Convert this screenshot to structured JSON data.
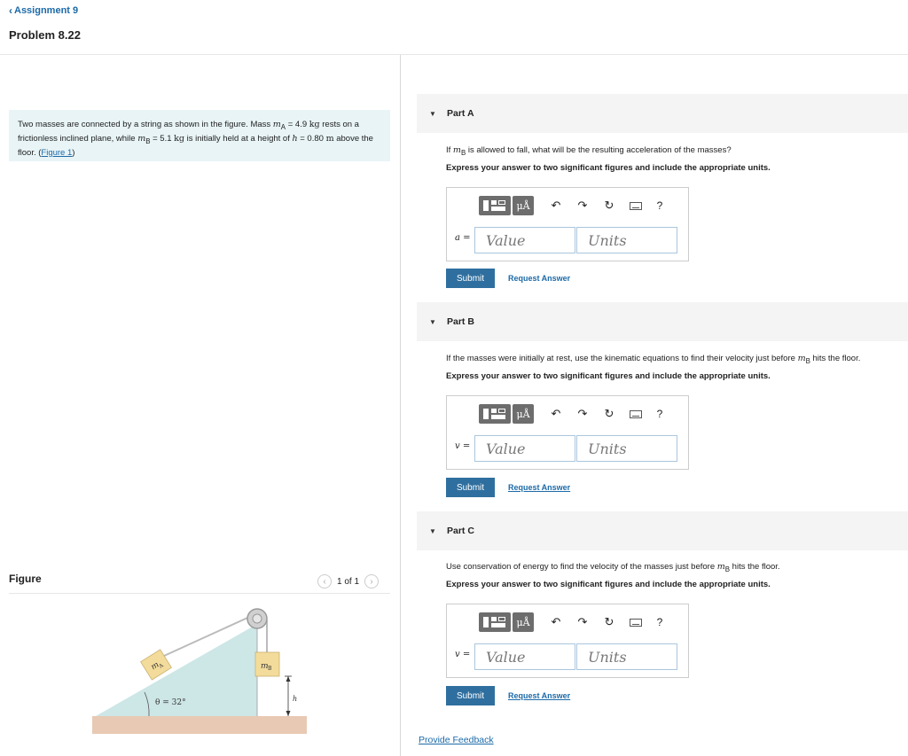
{
  "nav": {
    "back_label": "Assignment 9"
  },
  "problem": {
    "title": "Problem 8.22"
  },
  "statement": {
    "t1": "Two masses are connected by a string as shown in the figure. Mass ",
    "mA_sym": "m",
    "mA_sub": "A",
    "t2": " = 4.9 ",
    "kg1": "kg",
    "t3": " rests on a frictionless inclined plane, while ",
    "mB_sym": "m",
    "mB_sub": "B",
    "t4": " = 5.1 ",
    "kg2": "kg",
    "t5": " is initially held at a height of ",
    "h_sym": "h",
    "t6": " = 0.80 ",
    "m_unit": "m",
    "t7": " above the floor. (",
    "figure_link": "Figure 1",
    "t8": ")"
  },
  "figure": {
    "label": "Figure",
    "pager": "1 of 1",
    "mA_label": "m",
    "mA_sub": "A",
    "mB_label": "m",
    "mB_sub": "B",
    "h_label": "h",
    "angle_label": "θ = 32°"
  },
  "toolbar": {
    "mu_label": "μÅ",
    "undo_icon": "↶",
    "redo_icon": "↷",
    "reset_icon": "↻",
    "help_label": "?"
  },
  "parts": [
    {
      "title": "Part A",
      "question_pre": "If ",
      "question_sym": "m",
      "question_sub": "B",
      "question_post": " is allowed to fall, what will be the resulting acceleration of the masses?",
      "instruction": "Express your answer to two significant figures and include the appropriate units.",
      "var_label": "a =",
      "value_placeholder": "Value",
      "units_placeholder": "Units",
      "submit_label": "Submit",
      "request_label": "Request Answer"
    },
    {
      "title": "Part B",
      "question_pre": "If the masses were initially at rest, use the kinematic equations to find their velocity just before ",
      "question_sym": "m",
      "question_sub": "B",
      "question_post": " hits the floor.",
      "instruction": "Express your answer to two significant figures and include the appropriate units.",
      "var_label": "v =",
      "value_placeholder": "Value",
      "units_placeholder": "Units",
      "submit_label": "Submit",
      "request_label": "Request Answer"
    },
    {
      "title": "Part C",
      "question_pre": "Use conservation of energy to find the velocity of the masses just before ",
      "question_sym": "m",
      "question_sub": "B",
      "question_post": " hits the floor.",
      "instruction": "Express your answer to two significant figures and include the appropriate units.",
      "var_label": "v =",
      "value_placeholder": "Value",
      "units_placeholder": "Units",
      "submit_label": "Submit",
      "request_label": "Request Answer"
    }
  ],
  "footer": {
    "feedback_label": "Provide Feedback"
  }
}
